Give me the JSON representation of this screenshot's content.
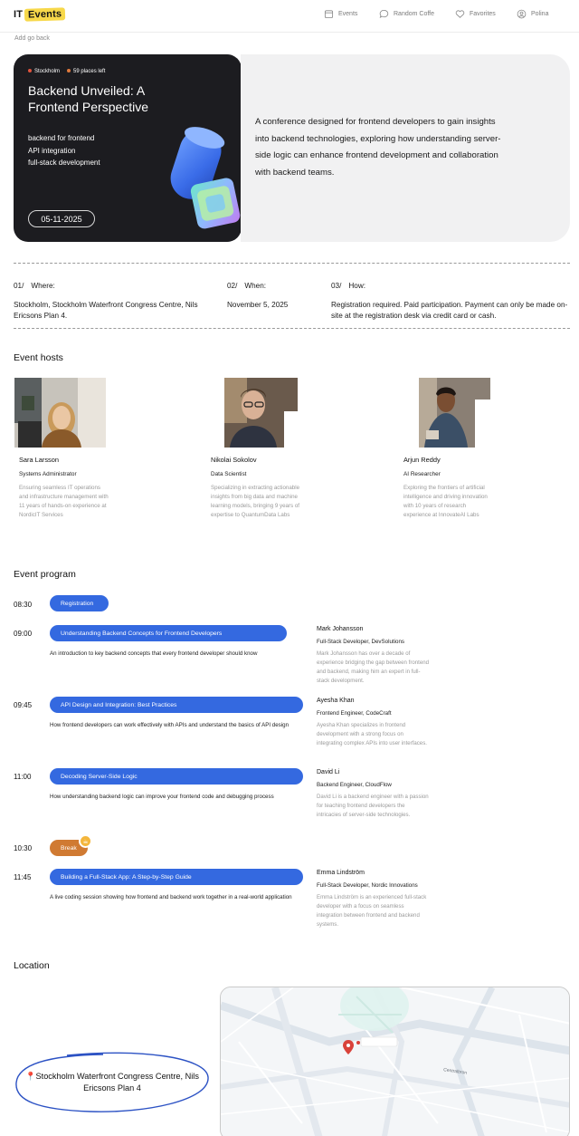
{
  "header": {
    "logo_it": "IT",
    "logo_events": "Events",
    "nav": [
      {
        "label": "Events",
        "icon": "calendar-icon"
      },
      {
        "label": "Random Coffe",
        "icon": "chat-bubble-icon"
      },
      {
        "label": "Favorites",
        "icon": "heart-icon"
      },
      {
        "label": "Polina",
        "icon": "user-icon"
      }
    ]
  },
  "back_label": "Add go back",
  "hero": {
    "city": "Stockholm",
    "places": "59 places left",
    "title": "Backend Unveiled: A Frontend Perspective",
    "tags": [
      "backend for frontend",
      "API integration",
      "full-stack development"
    ],
    "date": "05-11-2025",
    "description": "A conference designed for frontend developers to gain insights into backend technologies, exploring how understanding server-side logic can enhance frontend development and collaboration with backend teams."
  },
  "info": [
    {
      "num": "01/",
      "label": "Where:",
      "text": "Stockholm, Stockholm Waterfront Congress Centre, Nils Ericsons Plan 4."
    },
    {
      "num": "02/",
      "label": "When:",
      "text": "November 5, 2025"
    },
    {
      "num": "03/",
      "label": "How:",
      "text": "Registration required. Paid participation. Payment can only be made on-site at the registration desk via credit card or cash."
    }
  ],
  "hosts_title": "Event hosts",
  "hosts": [
    {
      "name": "Sara Larsson",
      "role": "Systems Administrator",
      "bio": "Ensuring seamless IT operations and infrastructure management with 11 years of hands-on experience at NordicIT Services"
    },
    {
      "name": "Nikolai Sokolov",
      "role": "Data Scientist",
      "bio": "Specializing in extracting actionable insights from big data and machine learning models, bringing 9 years of expertise to QuantumData Labs"
    },
    {
      "name": "Arjun Reddy",
      "role": "AI Researcher",
      "bio": "Exploring the frontiers of artificial intelligence and driving innovation with 10 years of research experience at InnovateAI Labs"
    }
  ],
  "program_title": "Event program",
  "program": [
    {
      "time": "08:30",
      "title": "Registration"
    },
    {
      "time": "09:00",
      "title": "Understanding Backend Concepts for Frontend Developers",
      "desc": "An introduction to key backend concepts that every frontend developer should know",
      "speaker": "Mark Johansson",
      "speaker_role": "Full-Stack Developer, DevSolutions",
      "speaker_bio": "Mark Johansson has over a decade of experience bridging the gap between frontend and backend, making him an expert in full-stack development."
    },
    {
      "time": "09:45",
      "title": "API Design and Integration: Best Practices",
      "desc": "How frontend developers can work effectively with APIs and understand the basics of API design",
      "speaker": "Ayesha Khan",
      "speaker_role": "Frontend Engineer, CodeCraft",
      "speaker_bio": "Ayesha Khan specializes in frontend development with a strong focus on integrating complex APIs into user interfaces."
    },
    {
      "time": "11:00",
      "title": "Decoding Server-Side Logic",
      "desc": "How understanding backend logic can improve your frontend code and debugging process",
      "speaker": "David Li",
      "speaker_role": "Backend Engineer, CloudFlow",
      "speaker_bio": "David Li is a backend engineer with a passion for teaching frontend developers the intricacies of server-side technologies."
    },
    {
      "time": "10:30",
      "title": "Break",
      "badge": "☕"
    },
    {
      "time": "11:45",
      "title": "Building a Full-Stack App: A Step-by-Step Guide",
      "desc": "A live coding session showing how frontend and backend work together in a real-world application",
      "speaker": "Emma Lindström",
      "speaker_role": "Full-Stack Developer, Nordic Innovations",
      "speaker_bio": "Emma Lindström is an experienced full-stack developer with a focus on seamless integration between frontend and backend systems."
    }
  ],
  "location_title": "Location",
  "location_address": "Stockholm Waterfront Congress Centre, Nils Ericsons Plan 4",
  "map": {
    "street_label": "Centralbron"
  },
  "colors": {
    "accent": "#3469e0",
    "break": "#d07a32",
    "logo_highlight": "#f7d84a",
    "dark_card": "#1c1c20"
  }
}
